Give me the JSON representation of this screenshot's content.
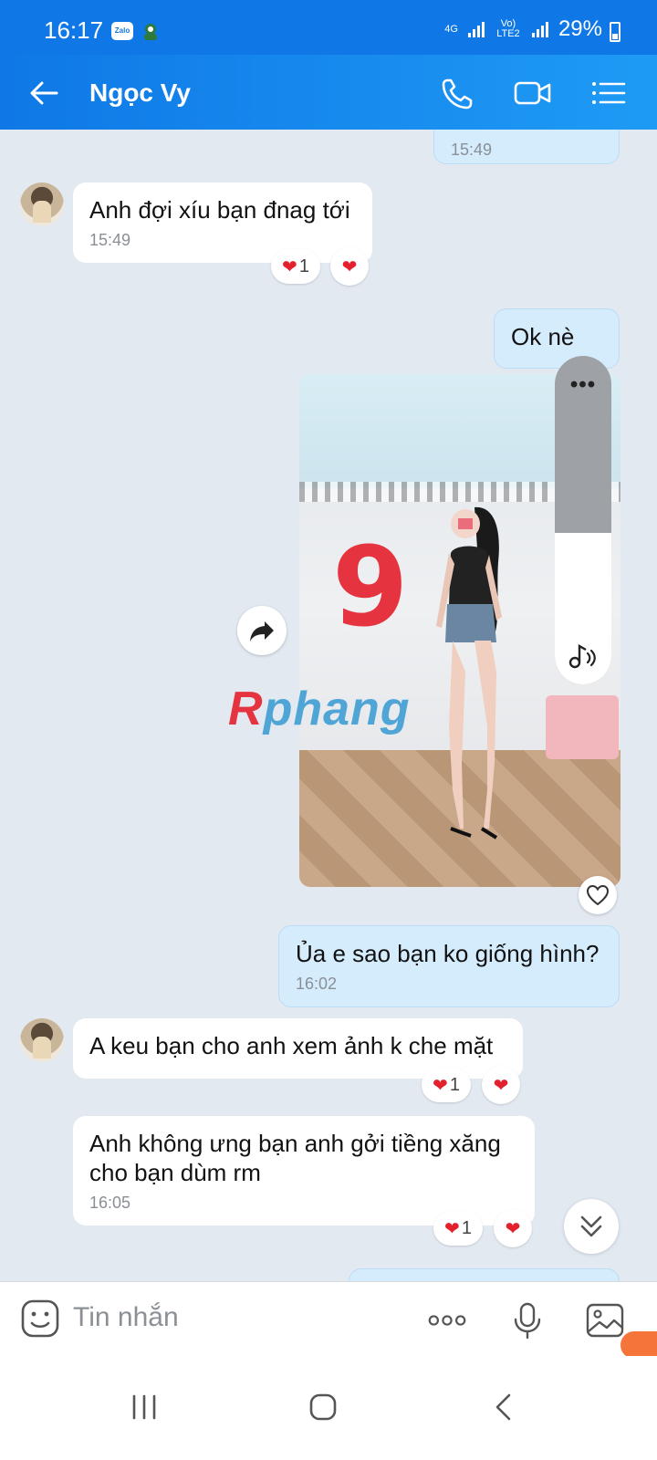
{
  "status_bar": {
    "time": "16:17",
    "zalo_badge": "Zalo",
    "network_primary": "4G",
    "network_secondary": "Vo) LTE2",
    "battery": "29%"
  },
  "header": {
    "contact_name": "Ngọc Vy"
  },
  "messages": {
    "top_partial_time": "15:49",
    "m1": {
      "text": "Anh đợi xíu bạn đnag tới",
      "time": "15:49",
      "reaction_count": "1"
    },
    "m2": {
      "text": "Ok nè"
    },
    "photo": {
      "number_shown": "9"
    },
    "m3": {
      "text": "Ủa e sao bạn ko giống hình?",
      "time": "16:02"
    },
    "m4": {
      "text": "A keu bạn cho anh xem ảnh k che mặt",
      "reaction_count": "1"
    },
    "m5": {
      "text": "Anh không ưng bạn anh gởi tiềng xăng cho bạn dùm rm",
      "time": "16:05",
      "reaction_count": "1"
    }
  },
  "volume_overlay": {
    "level": 0.46,
    "more_label": "•••"
  },
  "watermark": {
    "first": "R",
    "rest": "phang"
  },
  "composer": {
    "placeholder": "Tin nhắn"
  },
  "colors": {
    "accent": "#0f78e6",
    "heart": "#e3212d",
    "bubble_out": "#d5ecfd"
  }
}
